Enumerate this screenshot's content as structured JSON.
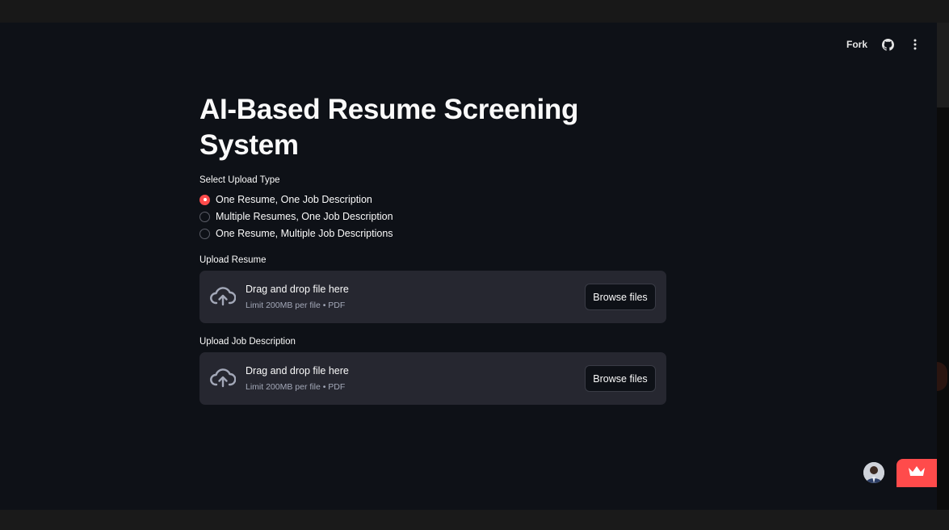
{
  "toolbar": {
    "fork_label": "Fork",
    "github_icon": "github-icon",
    "menu_icon": "kebab-menu-icon"
  },
  "page": {
    "title": "AI-Based Resume Screening System"
  },
  "upload_type": {
    "label": "Select Upload Type",
    "options": [
      {
        "label": "One Resume, One Job Description",
        "selected": true
      },
      {
        "label": "Multiple Resumes, One Job Description",
        "selected": false
      },
      {
        "label": "One Resume, Multiple Job Descriptions",
        "selected": false
      }
    ]
  },
  "resume_upload": {
    "label": "Upload Resume",
    "title": "Drag and drop file here",
    "limit": "Limit 200MB per file • PDF",
    "button": "Browse files",
    "icon": "cloud-upload-icon"
  },
  "jd_upload": {
    "label": "Upload Job Description",
    "title": "Drag and drop file here",
    "limit": "Limit 200MB per file • PDF",
    "button": "Browse files",
    "icon": "cloud-upload-icon"
  },
  "footer": {
    "avatar_icon": "user-avatar",
    "badge_icon": "crown-icon"
  },
  "colors": {
    "background": "#0e1117",
    "panel": "#262730",
    "accent": "#ff4b4b",
    "text": "#fafafa"
  }
}
